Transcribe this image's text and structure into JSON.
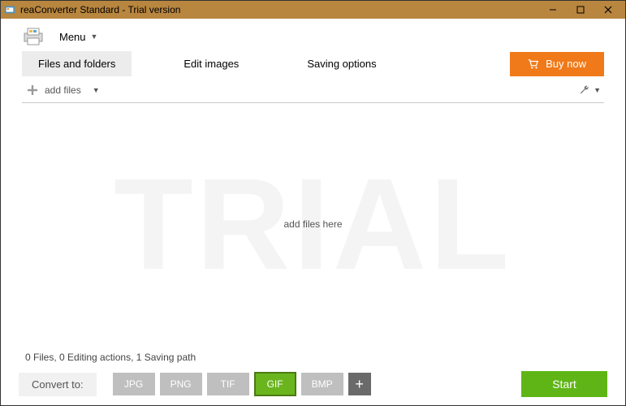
{
  "window": {
    "title": "reaConverter Standard - Trial version"
  },
  "menu": {
    "label": "Menu"
  },
  "tabs": {
    "files": "Files and folders",
    "edit": "Edit images",
    "saving": "Saving options"
  },
  "buy": {
    "label": "Buy now"
  },
  "addfiles": {
    "label": "add files"
  },
  "droparea": {
    "watermark": "TRIAL",
    "hint": "add files here"
  },
  "status": {
    "text": "0 Files, 0 Editing actions, 1 Saving path"
  },
  "convert": {
    "label": "Convert to:",
    "formats": [
      "JPG",
      "PNG",
      "TIF",
      "GIF",
      "BMP"
    ],
    "selected": "GIF"
  },
  "start": {
    "label": "Start"
  }
}
